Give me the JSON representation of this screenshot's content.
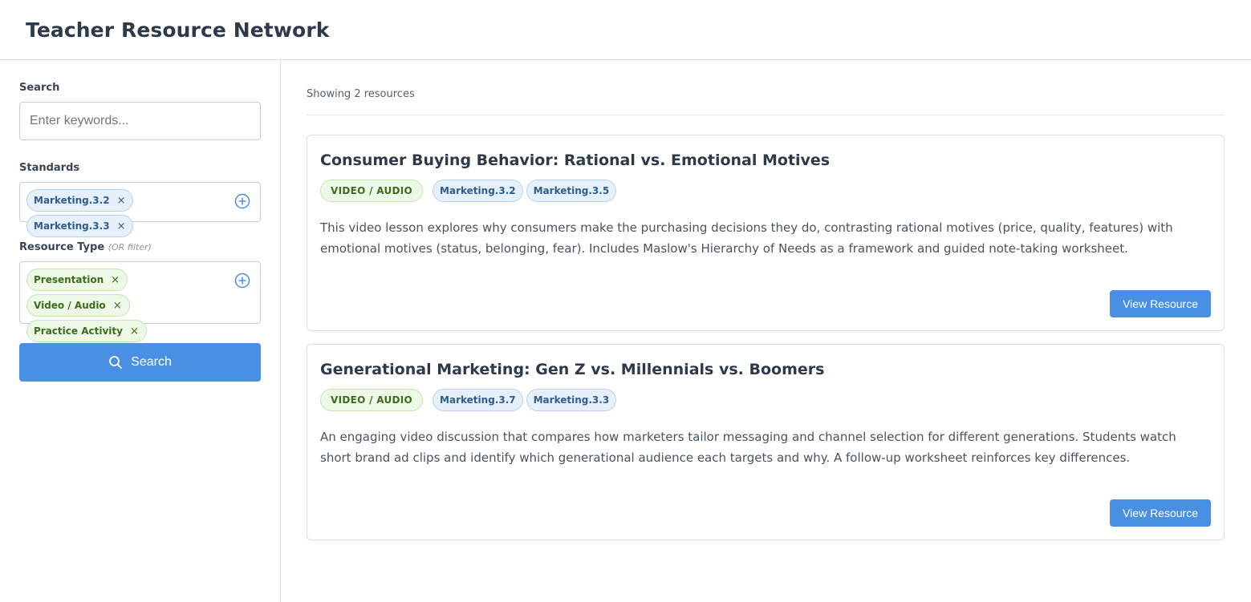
{
  "header": {
    "title": "Teacher Resource Network"
  },
  "sidebar": {
    "search_label": "Search",
    "search_placeholder": "Enter keywords...",
    "standards_label": "Standards",
    "standards": [
      "Marketing.3.2",
      "Marketing.3.3"
    ],
    "resource_type_label": "Resource Type",
    "resource_type_hint": "(OR filter)",
    "resource_types": [
      "Presentation",
      "Video / Audio",
      "Practice Activity"
    ],
    "remove_glyph": "×",
    "search_button_label": "Search"
  },
  "main": {
    "count_text": "Showing 2 resources",
    "view_button_label": "View Resource",
    "resources": [
      {
        "title": "Consumer Buying Behavior: Rational vs. Emotional Motives",
        "type": "Video / Audio",
        "standards": [
          "Marketing.3.2",
          "Marketing.3.5"
        ],
        "description": "This video lesson explores why consumers make the purchasing decisions they do, contrasting rational motives (price, quality, features) with emotional motives (status, belonging, fear). Includes Maslow's Hierarchy of Needs as a framework and guided note-taking worksheet."
      },
      {
        "title": "Generational Marketing: Gen Z vs. Millennials vs. Boomers",
        "type": "Video / Audio",
        "standards": [
          "Marketing.3.7",
          "Marketing.3.3"
        ],
        "description": "An engaging video discussion that compares how marketers tailor messaging and channel selection for different generations. Students watch short brand ad clips and identify which generational audience each targets and why. A follow-up worksheet reinforces key differences."
      }
    ]
  },
  "colors": {
    "accent": "#4a90e2",
    "standard_chip_bg": "#e6f0fa",
    "type_chip_bg": "#eef8e6"
  },
  "icons": {
    "search": "search-icon",
    "add": "plus-circle-icon",
    "remove": "close-icon"
  }
}
